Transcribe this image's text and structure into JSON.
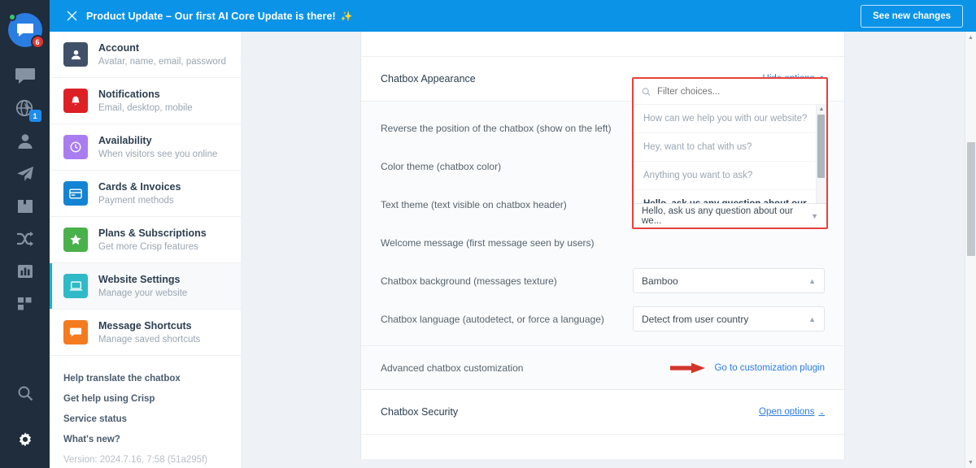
{
  "banner": {
    "title": "Product Update – Our first AI Core Update is there!",
    "emoji": "✨",
    "close_icon": "close-icon",
    "button_label": "See new changes"
  },
  "rail": {
    "avatar_badge": "6",
    "globe_badge": "1",
    "items": [
      {
        "icon": "chat-bubble-icon",
        "name": "conversations"
      },
      {
        "icon": "globe-icon",
        "name": "visitors"
      },
      {
        "icon": "person-icon",
        "name": "contacts"
      },
      {
        "icon": "paper-plane-icon",
        "name": "campaigns"
      },
      {
        "icon": "book-icon",
        "name": "helpdesk"
      },
      {
        "icon": "shuffle-icon",
        "name": "routing"
      },
      {
        "icon": "bar-chart-icon",
        "name": "analytics"
      },
      {
        "icon": "grid-icon",
        "name": "plugins"
      }
    ],
    "bottom": [
      {
        "icon": "search-icon",
        "name": "search"
      },
      {
        "icon": "gear-icon",
        "name": "settings"
      }
    ]
  },
  "sidebar": {
    "items": [
      {
        "title": "Account",
        "subtitle": "Avatar, name, email, password",
        "color": "#3f5068",
        "icon": "person-icon",
        "active": false
      },
      {
        "title": "Notifications",
        "subtitle": "Email, desktop, mobile",
        "color": "#dd1f26",
        "icon": "bell-icon",
        "active": false
      },
      {
        "title": "Availability",
        "subtitle": "When visitors see you online",
        "color": "#a97df0",
        "icon": "clock-icon",
        "active": false
      },
      {
        "title": "Cards & Invoices",
        "subtitle": "Payment methods",
        "color": "#1383d4",
        "icon": "credit-card-icon",
        "active": false
      },
      {
        "title": "Plans & Subscriptions",
        "subtitle": "Get more Crisp features",
        "color": "#49b14b",
        "icon": "star-icon",
        "active": false
      },
      {
        "title": "Website Settings",
        "subtitle": "Manage your website",
        "color": "#2ebac6",
        "icon": "laptop-icon",
        "active": true
      },
      {
        "title": "Message Shortcuts",
        "subtitle": "Manage saved shortcuts",
        "color": "#f57b20",
        "icon": "message-icon",
        "active": false
      }
    ],
    "links": [
      "Help translate the chatbox",
      "Get help using Crisp",
      "Service status",
      "What's new?"
    ],
    "version": "Version: 2024.7.16, 7:58 (51a295f)"
  },
  "main": {
    "appearance": {
      "title": "Chatbox Appearance",
      "toggle_label": "Hide options",
      "toggle_caret": "⌃",
      "fields": [
        {
          "label": "Reverse the position of the chatbox (show on the left)",
          "value": "",
          "control": "hidden"
        },
        {
          "label": "Color theme (chatbox color)",
          "value": "",
          "control": "hidden"
        },
        {
          "label": "Text theme (text visible on chatbox header)",
          "value": "",
          "control": "hidden"
        },
        {
          "label": "Welcome message (first message seen by users)",
          "value": "",
          "control": "hidden"
        },
        {
          "label": "Chatbox background (messages texture)",
          "value": "Bamboo",
          "control": "select"
        },
        {
          "label": "Chatbox language (autodetect, or force a language)",
          "value": "Detect from user country",
          "control": "select"
        }
      ]
    },
    "dropdown": {
      "search_placeholder": "Filter choices...",
      "search_icon": "search-icon",
      "options": [
        {
          "label": "How can we help you with our website?",
          "selected": false
        },
        {
          "label": "Hey, want to chat with us?",
          "selected": false
        },
        {
          "label": "Anything you want to ask?",
          "selected": false
        },
        {
          "label": "Hello, ask us any question about our we...",
          "selected": true
        }
      ],
      "current_value": "Hello, ask us any question about our we...",
      "scroll_up": "▲",
      "scroll_down": "▼",
      "highlight_color": "#e8413c"
    },
    "advanced": {
      "label": "Advanced chatbox customization",
      "link": "Go to customization plugin",
      "annotation_icon": "red-arrow-annotation"
    },
    "security": {
      "title": "Chatbox Security",
      "toggle_label": "Open options",
      "toggle_caret": "⌄"
    }
  },
  "scrollbar": {
    "up_arrow": "▲",
    "down_arrow": "▼"
  },
  "colors": {
    "banner_blue": "#0b93e8",
    "link_blue": "#2a7de1",
    "accent_teal": "#14b5c4",
    "annotation_red": "#e8413c",
    "rail_dark": "#1f2d3d"
  }
}
